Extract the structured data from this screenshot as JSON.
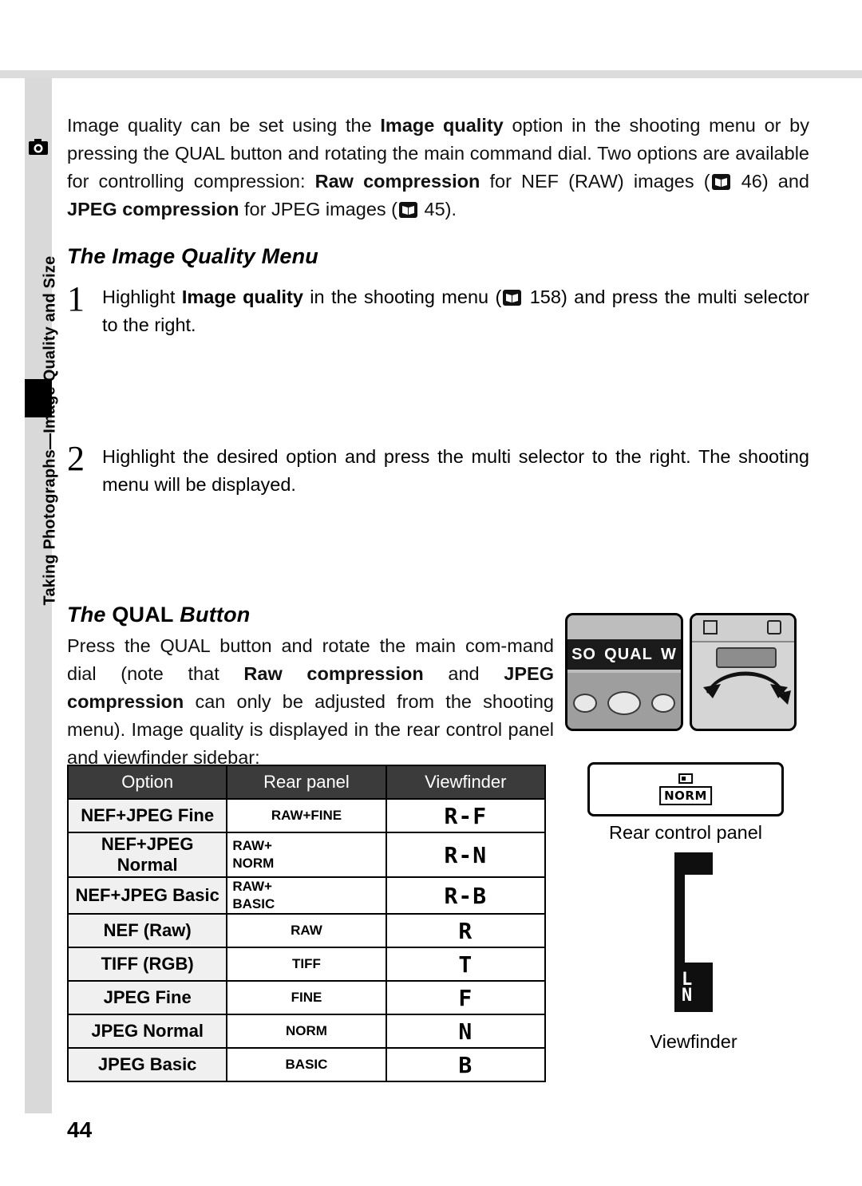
{
  "page": {
    "number": "44",
    "rail_label": "Taking Photographs—Image Quality and Size",
    "rail_icon": "camera-icon"
  },
  "intro": {
    "line1_a": "Image quality can be set using the ",
    "line1_b": "Image quality",
    "line1_c": " option in the shooting menu or by pressing the ",
    "qual": "QUAL",
    "line1_d": " button and rotating the main command dial. Two options are available for controlling compression: ",
    "line1_e": "Raw compression",
    "line1_f": " for NEF (RAW) images (",
    "ref46": "46",
    "line1_g": ") and ",
    "line1_h": "JPEG compression",
    "line1_i": " for JPEG images (",
    "ref45": "45",
    "line1_j": ")."
  },
  "menu_section": {
    "heading": "The Image Quality Menu",
    "steps": [
      {
        "num": "1",
        "text_a": "Highlight ",
        "bold": "Image quality",
        "text_b": " in the shooting menu (",
        "ref": "158",
        "text_c": ") and press the multi selector to the right."
      },
      {
        "num": "2",
        "text_a": "Highlight the desired option and press the multi selector to the right.  The shooting menu will be displayed.",
        "bold": "",
        "text_b": "",
        "ref": "",
        "text_c": ""
      }
    ]
  },
  "qual_section": {
    "heading_a": "The ",
    "heading_qual": "QUAL",
    "heading_b": " Button",
    "para_a": "Press the ",
    "para_qual": "QUAL",
    "para_b": " button and rotate the main com-mand dial (note that ",
    "para_bold1": "Raw compression",
    "para_c": " and ",
    "para_bold2": "JPEG compression",
    "para_d": " can only be adjusted from the shooting menu).  Image quality is displayed in the rear control panel and viewfinder sidebar:"
  },
  "table": {
    "headers": [
      "Option",
      "Rear panel",
      "Viewfinder"
    ],
    "rows": [
      {
        "option": "NEF+JPEG Fine",
        "rear": "RAW+FINE",
        "rear2": "",
        "viewfinder": "R-F"
      },
      {
        "option": "NEF+JPEG Normal",
        "rear": "RAW+",
        "rear2": "NORM",
        "viewfinder": "R-N"
      },
      {
        "option": "NEF+JPEG Basic",
        "rear": "RAW+",
        "rear2": "BASIC",
        "viewfinder": "R-B"
      },
      {
        "option": "NEF (Raw)",
        "rear": "RAW",
        "rear2": "",
        "viewfinder": "R"
      },
      {
        "option": "TIFF (RGB)",
        "rear": "TIFF",
        "rear2": "",
        "viewfinder": "T"
      },
      {
        "option": "JPEG Fine",
        "rear": "FINE",
        "rear2": "",
        "viewfinder": "F"
      },
      {
        "option": "JPEG Normal",
        "rear": "NORM",
        "rear2": "",
        "viewfinder": "N"
      },
      {
        "option": "JPEG Basic",
        "rear": "BASIC",
        "rear2": "",
        "viewfinder": "B"
      }
    ]
  },
  "figures": {
    "camera_lcd": [
      "SO",
      "QUAL",
      "W"
    ],
    "rear_panel_caption": "Rear control panel",
    "rear_panel_norm": "NORM",
    "viewfinder_caption": "Viewfinder",
    "viewfinder_letters": "L\nN"
  }
}
